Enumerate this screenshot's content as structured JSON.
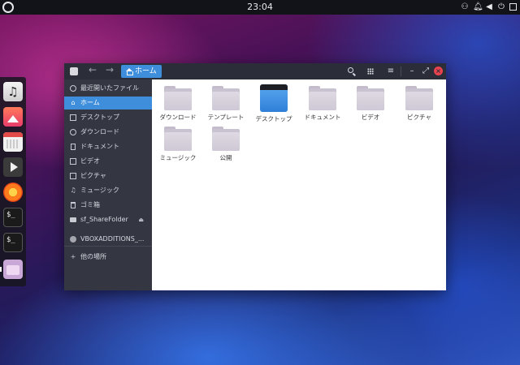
{
  "top_panel": {
    "clock": "23:04",
    "tray_icons": [
      "network-icon",
      "notification-icon",
      "volume-icon",
      "power-icon",
      "system-menu-icon"
    ]
  },
  "dock": {
    "items": [
      {
        "name": "music-app",
        "icon": "music-icon"
      },
      {
        "name": "photos-app",
        "icon": "photo-icon"
      },
      {
        "name": "calendar-app",
        "icon": "calendar-icon"
      },
      {
        "name": "video-app",
        "icon": "play-icon"
      },
      {
        "name": "firefox-app",
        "icon": "firefox-icon"
      },
      {
        "name": "terminal-app",
        "icon": "terminal-icon",
        "label": "$_"
      },
      {
        "name": "terminal-app-2",
        "icon": "terminal-icon",
        "label": "$_"
      },
      {
        "name": "files-app",
        "icon": "folder-icon"
      }
    ]
  },
  "window": {
    "path": {
      "label": "ホーム"
    },
    "sidebar": {
      "items": [
        {
          "label": "最近開いたファイル",
          "icon": "recent-icon"
        },
        {
          "label": "ホーム",
          "icon": "home-icon",
          "active": true
        },
        {
          "label": "デスクトップ",
          "icon": "desktop-icon"
        },
        {
          "label": "ダウンロード",
          "icon": "download-icon"
        },
        {
          "label": "ドキュメント",
          "icon": "document-icon"
        },
        {
          "label": "ビデオ",
          "icon": "video-icon"
        },
        {
          "label": "ピクチャ",
          "icon": "picture-icon"
        },
        {
          "label": "ミュージック",
          "icon": "music-icon"
        },
        {
          "label": "ゴミ箱",
          "icon": "trash-icon"
        },
        {
          "label": "sf_ShareFolder",
          "icon": "drive-icon",
          "eject": true
        },
        {
          "label": "VBOXADDITIONS_...",
          "icon": "disc-icon"
        },
        {
          "label": "他の場所",
          "icon": "plus-icon"
        }
      ]
    },
    "files": [
      {
        "label": "ダウンロード",
        "type": "folder"
      },
      {
        "label": "テンプレート",
        "type": "folder"
      },
      {
        "label": "デスクトップ",
        "type": "desktop"
      },
      {
        "label": "ドキュメント",
        "type": "folder"
      },
      {
        "label": "ビデオ",
        "type": "folder"
      },
      {
        "label": "ピクチャ",
        "type": "folder"
      },
      {
        "label": "ミュージック",
        "type": "folder"
      },
      {
        "label": "公開",
        "type": "folder"
      }
    ]
  },
  "colors": {
    "accent": "#3f8edb",
    "sidebar_bg": "#343742",
    "headerbar_bg": "#2b2e38",
    "close_button": "#e8434f"
  }
}
